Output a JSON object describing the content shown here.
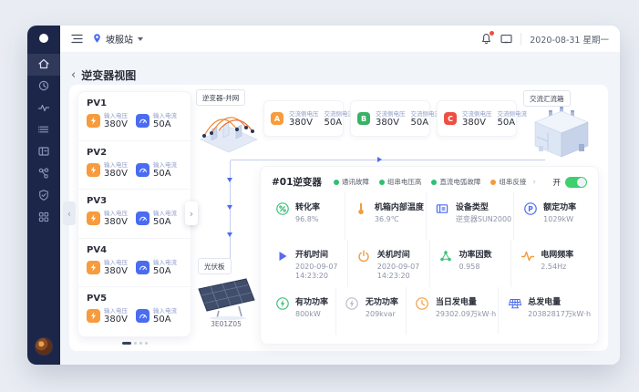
{
  "colors": {
    "accent": "#4a6cf0",
    "sidebar_bg": "#1c2649",
    "phase_a": "#f79b3c",
    "phase_b": "#36b365",
    "phase_c": "#ee4f43",
    "status_ok": "#2fbf71",
    "status_warn": "#f59b3c",
    "toggle_on": "#3ecf6f"
  },
  "header": {
    "station": "坡服站",
    "date": "2020-08-31 星期一"
  },
  "page": {
    "back": "‹",
    "title": "逆变器视图"
  },
  "pv": {
    "prev": "‹",
    "next": "›",
    "items": [
      {
        "name": "PV1",
        "voltage_label": "输入电压",
        "voltage": "380V",
        "current_label": "输入电流",
        "current": "50A"
      },
      {
        "name": "PV2",
        "voltage_label": "输入电压",
        "voltage": "380V",
        "current_label": "输入电流",
        "current": "50A"
      },
      {
        "name": "PV3",
        "voltage_label": "输入电压",
        "voltage": "380V",
        "current_label": "输入电流",
        "current": "50A"
      },
      {
        "name": "PV4",
        "voltage_label": "输入电压",
        "voltage": "380V",
        "current_label": "输入电流",
        "current": "50A"
      },
      {
        "name": "PV5",
        "voltage_label": "输入电压",
        "voltage": "380V",
        "current_label": "输入电流",
        "current": "50A"
      }
    ]
  },
  "diagram": {
    "inverter_label": "逆变器-并网",
    "combiner_label": "交流汇流箱",
    "pv_panel_label": "光伏板",
    "pv_panel_code": "3E01Z05",
    "phases": [
      {
        "badge": "A",
        "voltage_label": "交流侧电压",
        "voltage": "380V",
        "current_label": "交流侧电流",
        "current": "50A"
      },
      {
        "badge": "B",
        "voltage_label": "交流侧电压",
        "voltage": "380V",
        "current_label": "交流侧电流",
        "current": "50A"
      },
      {
        "badge": "C",
        "voltage_label": "交流侧电压",
        "voltage": "380V",
        "current_label": "交流侧电流",
        "current": "50A"
      }
    ]
  },
  "panel": {
    "title": "#01逆变器",
    "legend": [
      {
        "label": "通讯故障",
        "status": "ok"
      },
      {
        "label": "组串电压高",
        "status": "ok"
      },
      {
        "label": "直流电弧故障",
        "status": "ok"
      },
      {
        "label": "组串反接",
        "status": "warn"
      }
    ],
    "more": "›",
    "switch_label": "开",
    "switch_state": "on",
    "metrics": [
      {
        "title": "转化率",
        "value": "96.8%"
      },
      {
        "title": "机箱内部温度",
        "value": "36.9℃"
      },
      {
        "title": "设备类型",
        "value": "逆变器SUN2000"
      },
      {
        "title": "额定功率",
        "value": "1029kW"
      },
      {
        "title": "开机时间",
        "value": "2020-09-07",
        "value2": "14:23:20"
      },
      {
        "title": "关机时间",
        "value": "2020-09-07",
        "value2": "14:23:20"
      },
      {
        "title": "功率因数",
        "value": "0.958"
      },
      {
        "title": "电网频率",
        "value": "2.54Hz"
      },
      {
        "title": "有功功率",
        "value": "800kW"
      },
      {
        "title": "无功功率",
        "value": "209kvar"
      },
      {
        "title": "当日发电量",
        "value": "29302.09万kW·h"
      },
      {
        "title": "总发电量",
        "value": "20382817万kW·h"
      }
    ]
  }
}
